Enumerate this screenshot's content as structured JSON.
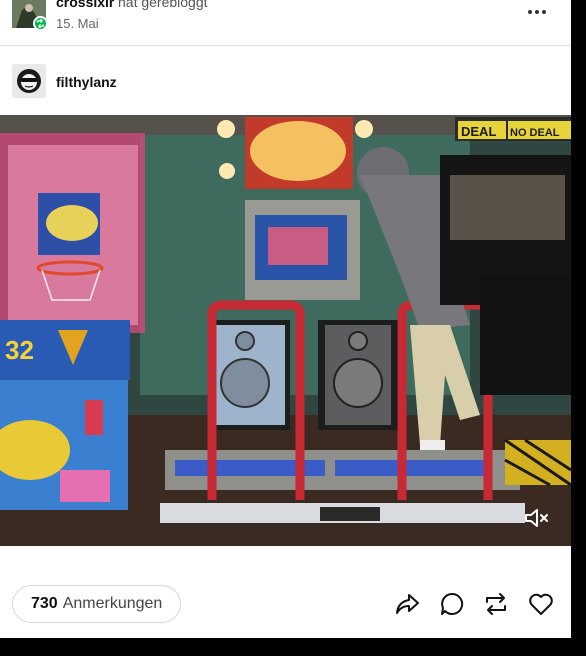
{
  "reblog": {
    "name": "crossixir",
    "action": "hat gerebloggt",
    "date": "15. Mai"
  },
  "post": {
    "author": "filthylanz"
  },
  "video": {
    "arcade_signs": {
      "basketball_score": "32",
      "deal_sign_left": "DEAL",
      "deal_sign_right": "NO DEAL"
    },
    "muted": true
  },
  "footer": {
    "notes_count": "730",
    "notes_label": "Anmerkungen"
  },
  "icons": {
    "more": "more-dots-icon",
    "share": "share-icon",
    "reply": "reply-icon",
    "reblog": "reblog-icon",
    "like": "heart-icon",
    "mute": "volume-muted-icon"
  },
  "colors": {
    "reblog_badge": "#00b84a",
    "card": "#ffffff",
    "page": "#000000"
  }
}
